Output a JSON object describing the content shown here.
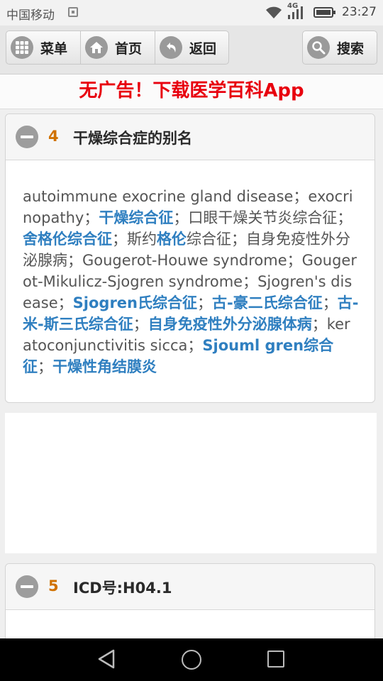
{
  "status_bar": {
    "carrier": "中国移动",
    "network": "4G",
    "time": "23:27"
  },
  "nav": {
    "menu": "菜单",
    "home": "首页",
    "back": "返回",
    "search": "搜索"
  },
  "ad_banner": "无广告！下载医学百科App",
  "sections": [
    {
      "number": "4",
      "title": "干燥综合症的别名",
      "segments": [
        {
          "text": "autoimmune exocrine gland disease；exocrinopathy；",
          "link": false
        },
        {
          "text": "干燥综合征",
          "link": true
        },
        {
          "text": "；口眼干燥关节炎综合征；",
          "link": false
        },
        {
          "text": "舍格伦综合征",
          "link": true
        },
        {
          "text": "；斯约",
          "link": false
        },
        {
          "text": "格伦",
          "link": true
        },
        {
          "text": "综合征；自身免疫性外分泌腺病；Gougerot-Houwe syndrome；Gougerot-Mikulicz-Sjogren syndrome；Sjogren's disease；",
          "link": false
        },
        {
          "text": "Sjogren氏综合征",
          "link": true
        },
        {
          "text": "；",
          "link": false
        },
        {
          "text": "古-豪二氏综合征",
          "link": true
        },
        {
          "text": "；",
          "link": false
        },
        {
          "text": "古-米-斯三氏综合征",
          "link": true
        },
        {
          "text": "；",
          "link": false
        },
        {
          "text": "自身免疫性外分泌腺体病",
          "link": true
        },
        {
          "text": "；keratoconjunctivitis sicca；",
          "link": false
        },
        {
          "text": "Sjouml gren综合征",
          "link": true
        },
        {
          "text": "；",
          "link": false
        },
        {
          "text": "干燥性角结膜炎",
          "link": true
        }
      ]
    },
    {
      "number": "5",
      "title": "ICD号:H04.1"
    }
  ],
  "colors": {
    "accent_red": "#e8000e",
    "link_blue": "#2f7fc0",
    "section_number_orange": "#d07100"
  }
}
